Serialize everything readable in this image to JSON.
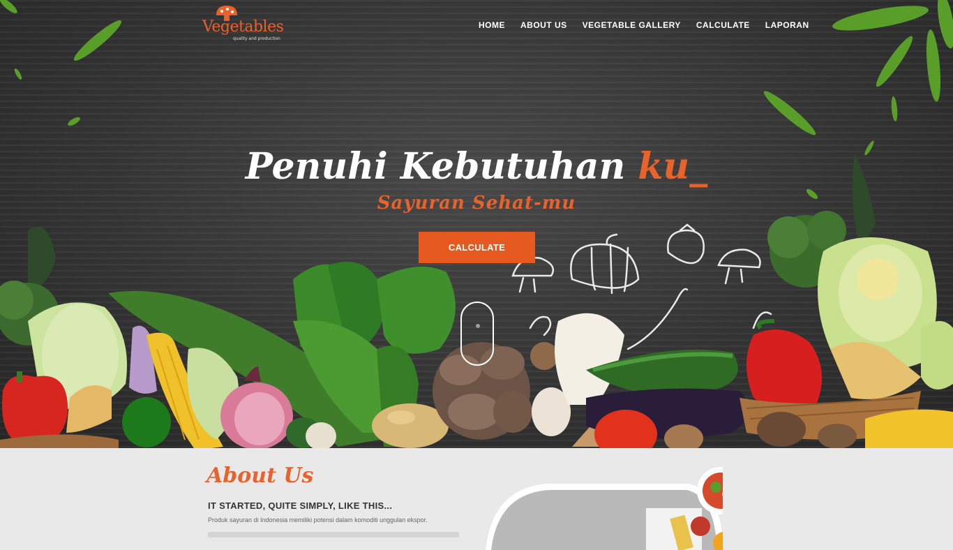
{
  "brand": {
    "name": "Vegetables",
    "tagline": "quality and production",
    "accent": "#e8622c"
  },
  "nav": {
    "items": [
      {
        "label": "HOME"
      },
      {
        "label": "ABOUT US"
      },
      {
        "label": "VEGETABLE GALLERY"
      },
      {
        "label": "CALCULATE"
      },
      {
        "label": "LAPORAN"
      }
    ]
  },
  "hero": {
    "headline_main": "Penuhi Kebutuhan ",
    "headline_accent": "ku_",
    "subline": "Sayuran Sehat-mu",
    "cta_label": "CALCULATE"
  },
  "about": {
    "title": "About Us",
    "subtitle": "IT STARTED, QUITE SIMPLY, LIKE THIS...",
    "body": "Produk sayuran di Indonesia memiliki potensi dalam komoditi unggulan ekspor."
  },
  "icons": {
    "logo": "mushroom-logo-icon",
    "scroll": "scroll-mouse-icon"
  }
}
